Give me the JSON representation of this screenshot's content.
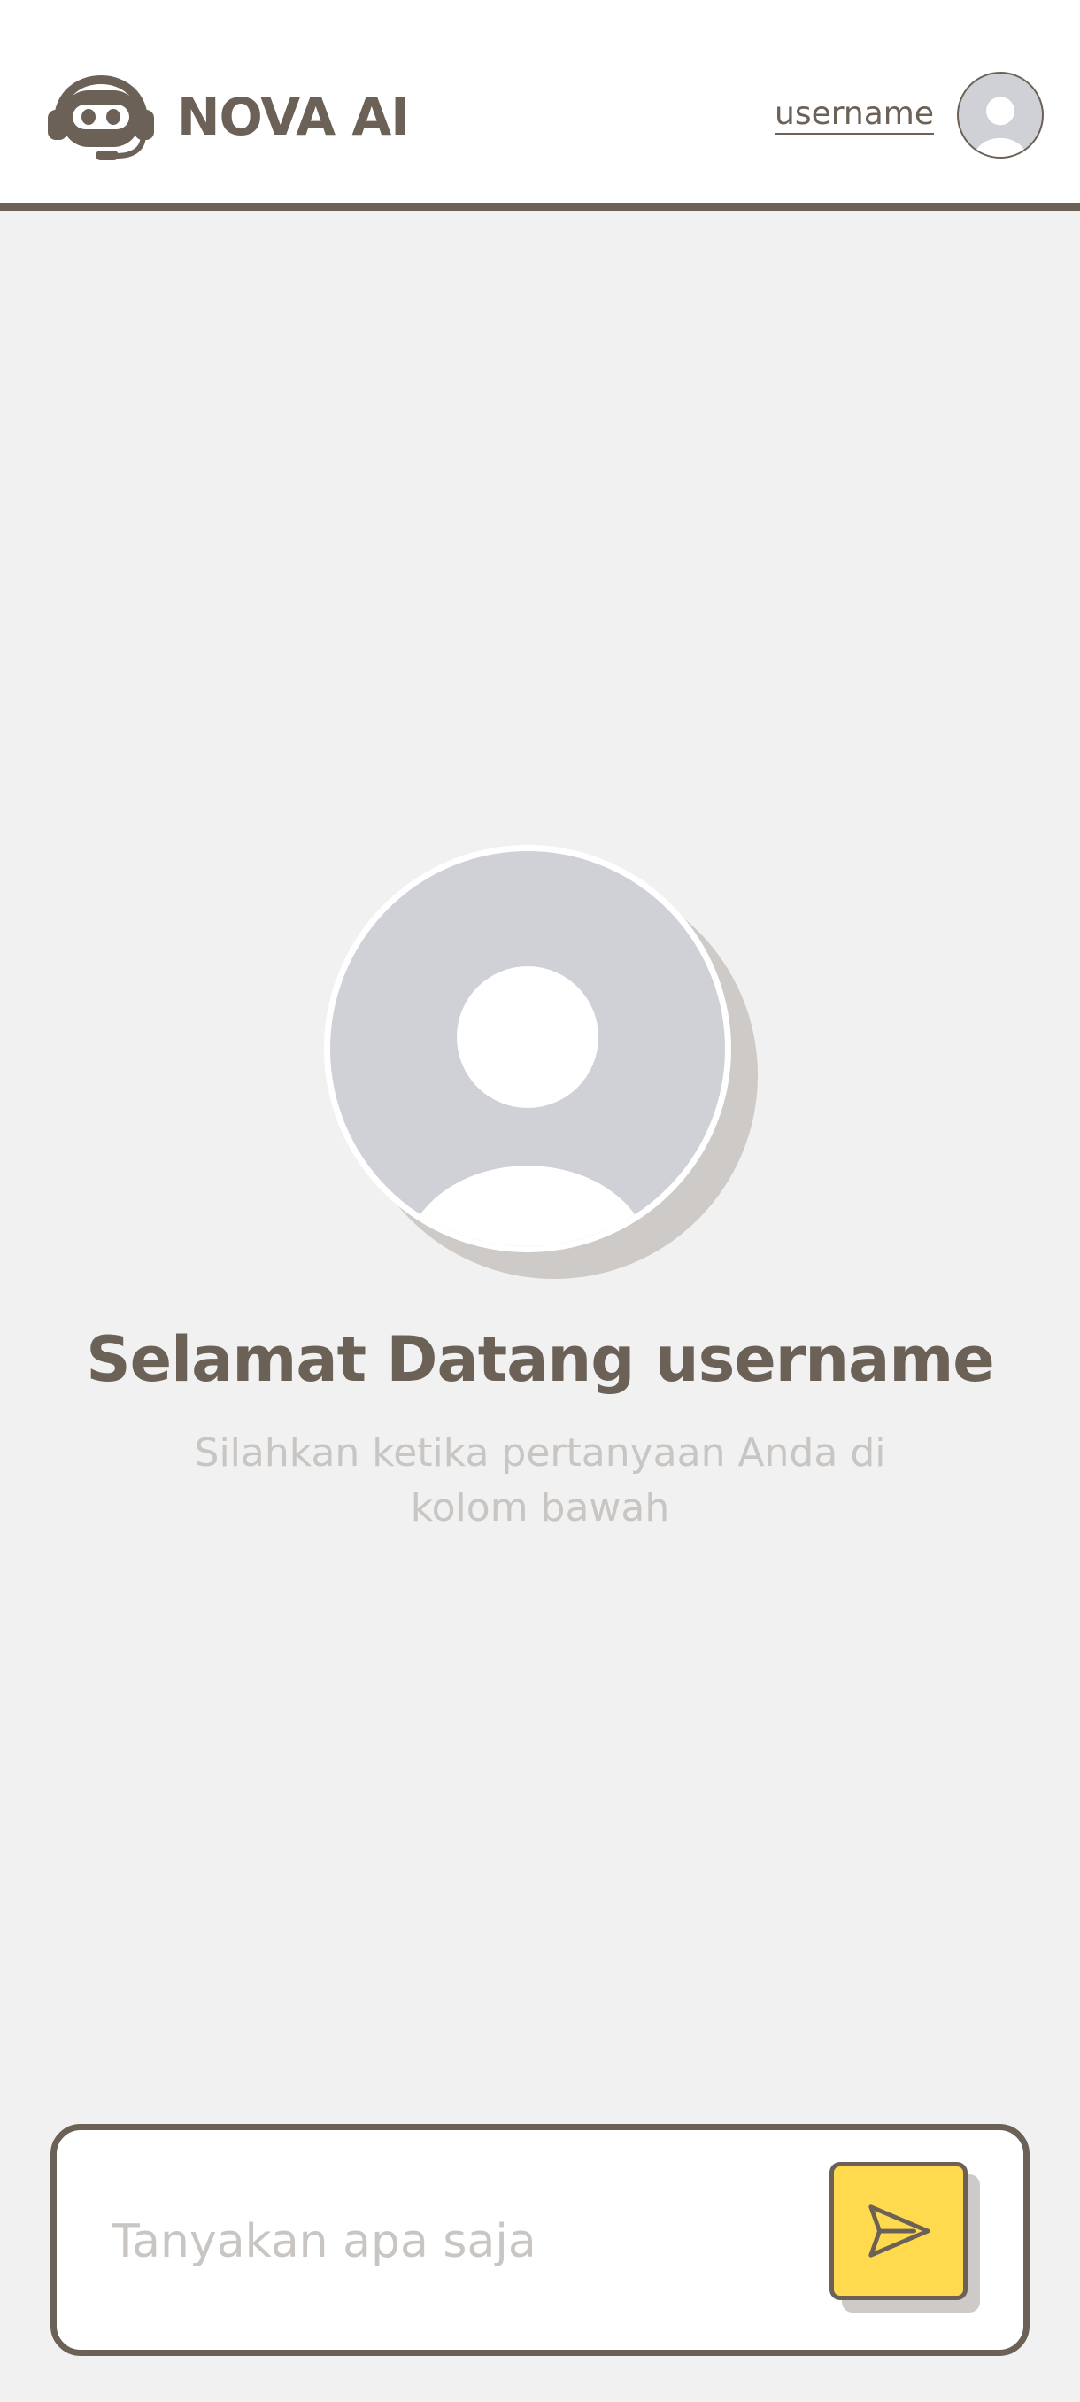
{
  "header": {
    "brand": "NOVA AI",
    "username": "username",
    "logo_icon": "robot-headset-icon",
    "avatar_icon": "user-avatar-icon"
  },
  "main": {
    "welcome": "Selamat Datang username",
    "subtitle": "Silahkan ketika pertanyaan Anda di kolom bawah",
    "avatar_icon": "user-avatar-icon"
  },
  "composer": {
    "placeholder": "Tanyakan apa saja",
    "send_icon": "send-icon"
  },
  "colors": {
    "brand": "#6b6157",
    "background": "#f1f1f1",
    "accent": "#ffda4f",
    "avatar_bg": "#d0d1d6",
    "muted_text": "#c8c5c2"
  }
}
